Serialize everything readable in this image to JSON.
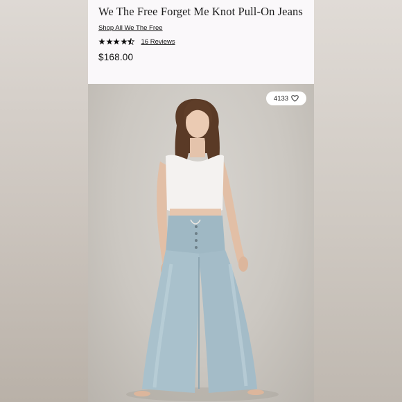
{
  "product": {
    "title": "We The Free Forget Me Knot Pull-On Jeans",
    "shop_link": "Shop All We The Free",
    "rating": 4.5,
    "reviews_label": "16 Reviews",
    "price": "$168.00"
  },
  "photo": {
    "likes_count": "4133",
    "like_icon": "heart-outline-icon"
  },
  "colors": {
    "denim": "#a9c1cc",
    "top": "#f4f2f0",
    "hair": "#5a3a26"
  }
}
